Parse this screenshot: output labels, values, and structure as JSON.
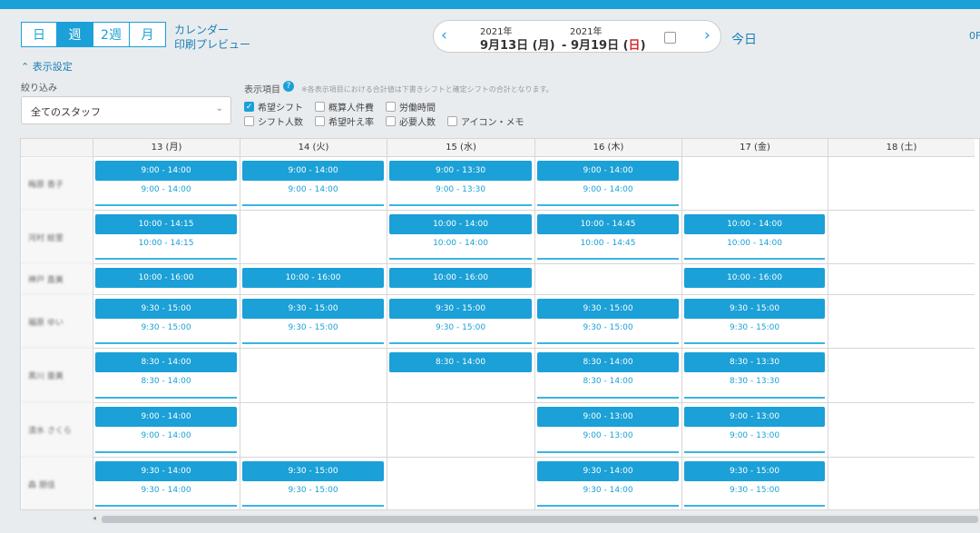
{
  "toolbar": {
    "views": [
      {
        "label": "日"
      },
      {
        "label": "週"
      },
      {
        "label": "2週"
      },
      {
        "label": "月"
      }
    ],
    "active_view": 1,
    "calendar_link": "カレンダー",
    "print_preview_link": "印刷プレビュー",
    "date_range": {
      "start_year": "2021年",
      "start_date": "9月13日 (月)",
      "separator": "-",
      "end_year": "2021年",
      "end_date_main": "9月19日 (",
      "end_weekday": "日",
      "end_close": ")"
    },
    "today": "今日",
    "corner_text": "0F"
  },
  "settings": {
    "toggle_label": "表示設定",
    "filter_label": "絞り込み",
    "filter_value": "全てのスタッフ",
    "items_label": "表示項目",
    "items_note": "※各表示項目における合計値は下書きシフトと確定シフトの合計となります。",
    "checkboxes": [
      {
        "label": "希望シフト",
        "checked": true
      },
      {
        "label": "概算人件費",
        "checked": false
      },
      {
        "label": "労働時間",
        "checked": false
      },
      {
        "label": "シフト人数",
        "checked": false
      },
      {
        "label": "希望叶え率",
        "checked": false
      },
      {
        "label": "必要人数",
        "checked": false
      },
      {
        "label": "アイコン・メモ",
        "checked": false
      }
    ]
  },
  "schedule": {
    "days": [
      "13 (月)",
      "14 (火)",
      "15 (水)",
      "16 (木)",
      "17 (金)",
      "18 (土)"
    ],
    "staff": [
      {
        "name": "梅原 香子",
        "shifts": [
          [
            "9:00 - 14:00",
            "9:00 - 14:00"
          ],
          [
            "9:00 - 14:00",
            "9:00 - 14:00"
          ],
          [
            "9:00 - 13:30",
            "9:00 - 13:30"
          ],
          [
            "9:00 - 14:00",
            "9:00 - 14:00"
          ],
          null,
          null
        ]
      },
      {
        "name": "河村 絵里",
        "shifts": [
          [
            "10:00 - 14:15",
            "10:00 - 14:15"
          ],
          null,
          [
            "10:00 - 14:00",
            "10:00 - 14:00"
          ],
          [
            "10:00 - 14:45",
            "10:00 - 14:45"
          ],
          [
            "10:00 - 14:00",
            "10:00 - 14:00"
          ],
          null
        ]
      },
      {
        "name": "神戸 直美",
        "shifts": [
          [
            "10:00 - 16:00",
            null
          ],
          [
            "10:00 - 16:00",
            null
          ],
          [
            "10:00 - 16:00",
            null
          ],
          null,
          [
            "10:00 - 16:00",
            null
          ],
          null
        ]
      },
      {
        "name": "福原 ゆい",
        "shifts": [
          [
            "9:30 - 15:00",
            "9:30 - 15:00"
          ],
          [
            "9:30 - 15:00",
            "9:30 - 15:00"
          ],
          [
            "9:30 - 15:00",
            "9:30 - 15:00"
          ],
          [
            "9:30 - 15:00",
            "9:30 - 15:00"
          ],
          [
            "9:30 - 15:00",
            "9:30 - 15:00"
          ],
          null
        ]
      },
      {
        "name": "黒川 亜美",
        "shifts": [
          [
            "8:30 - 14:00",
            "8:30 - 14:00"
          ],
          null,
          [
            "8:30 - 14:00",
            null
          ],
          [
            "8:30 - 14:00",
            "8:30 - 14:00"
          ],
          [
            "8:30 - 13:30",
            "8:30 - 13:30"
          ],
          null
        ]
      },
      {
        "name": "清水 さくら",
        "shifts": [
          [
            "9:00 - 14:00",
            "9:00 - 14:00"
          ],
          null,
          null,
          [
            "9:00 - 13:00",
            "9:00 - 13:00"
          ],
          [
            "9:00 - 13:00",
            "9:00 - 13:00"
          ],
          null
        ]
      },
      {
        "name": "森 朋佳",
        "shifts": [
          [
            "9:30 - 14:00",
            "9:30 - 14:00"
          ],
          [
            "9:30 - 15:00",
            "9:30 - 15:00"
          ],
          null,
          [
            "9:30 - 14:00",
            "9:30 - 14:00"
          ],
          [
            "9:30 - 15:00",
            "9:30 - 15:00"
          ],
          null
        ]
      }
    ]
  }
}
